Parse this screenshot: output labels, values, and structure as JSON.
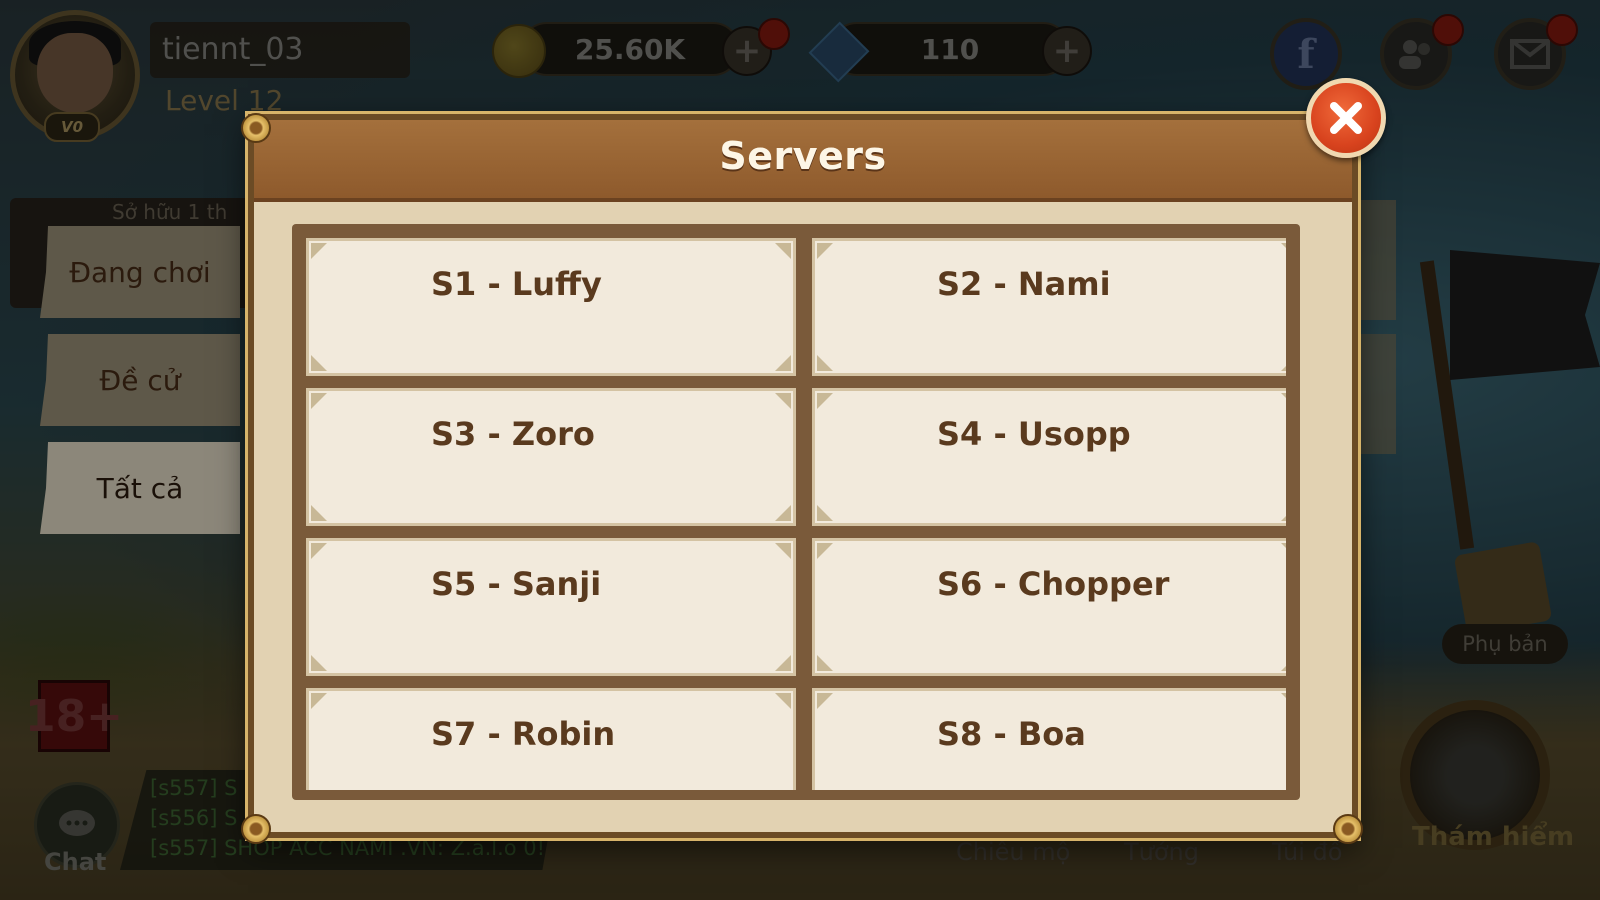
{
  "hud": {
    "username": "tiennt_03",
    "level": "Level 12",
    "vip": "V0",
    "coins": "25.60K",
    "gems": "110",
    "coin_icon": "coin-icon",
    "gem_icon": "gem-icon",
    "add_symbol": "+"
  },
  "left_tabs": {
    "owned_text": "Sở hữu 1 th",
    "items": [
      {
        "label": "Đang chơi"
      },
      {
        "label": "Đề cử"
      },
      {
        "label": "Tất cả",
        "active": true
      }
    ]
  },
  "age_rating": "18+",
  "chat": {
    "label": "Chat",
    "lines": [
      "[s557] S",
      "[s556] S",
      "[s557] SHOP ACC NAMI .VN: Z.a.l.o 0!"
    ]
  },
  "right_side": {
    "phu_ban": "Phụ bản",
    "tham_hiem": "Thám hiểm"
  },
  "bottom_nav": [
    "Chiêu mộ",
    "Tướng",
    "Túi đồ"
  ],
  "modal": {
    "title": "Servers",
    "close_icon": "close-icon",
    "servers": [
      {
        "label": "S1 - Luffy"
      },
      {
        "label": "S2 - Nami"
      },
      {
        "label": "S3 - Zoro"
      },
      {
        "label": "S4 - Usopp"
      },
      {
        "label": "S5 - Sanji"
      },
      {
        "label": "S6 - Chopper"
      },
      {
        "label": "S7 - Robin"
      },
      {
        "label": "S8 - Boa"
      }
    ]
  },
  "colors": {
    "modal_header": "#8e5a2c",
    "modal_body": "#e2d2b2",
    "card_bg": "#f2eadc",
    "card_text": "#5a3a1e",
    "close_button": "#d8431e"
  }
}
